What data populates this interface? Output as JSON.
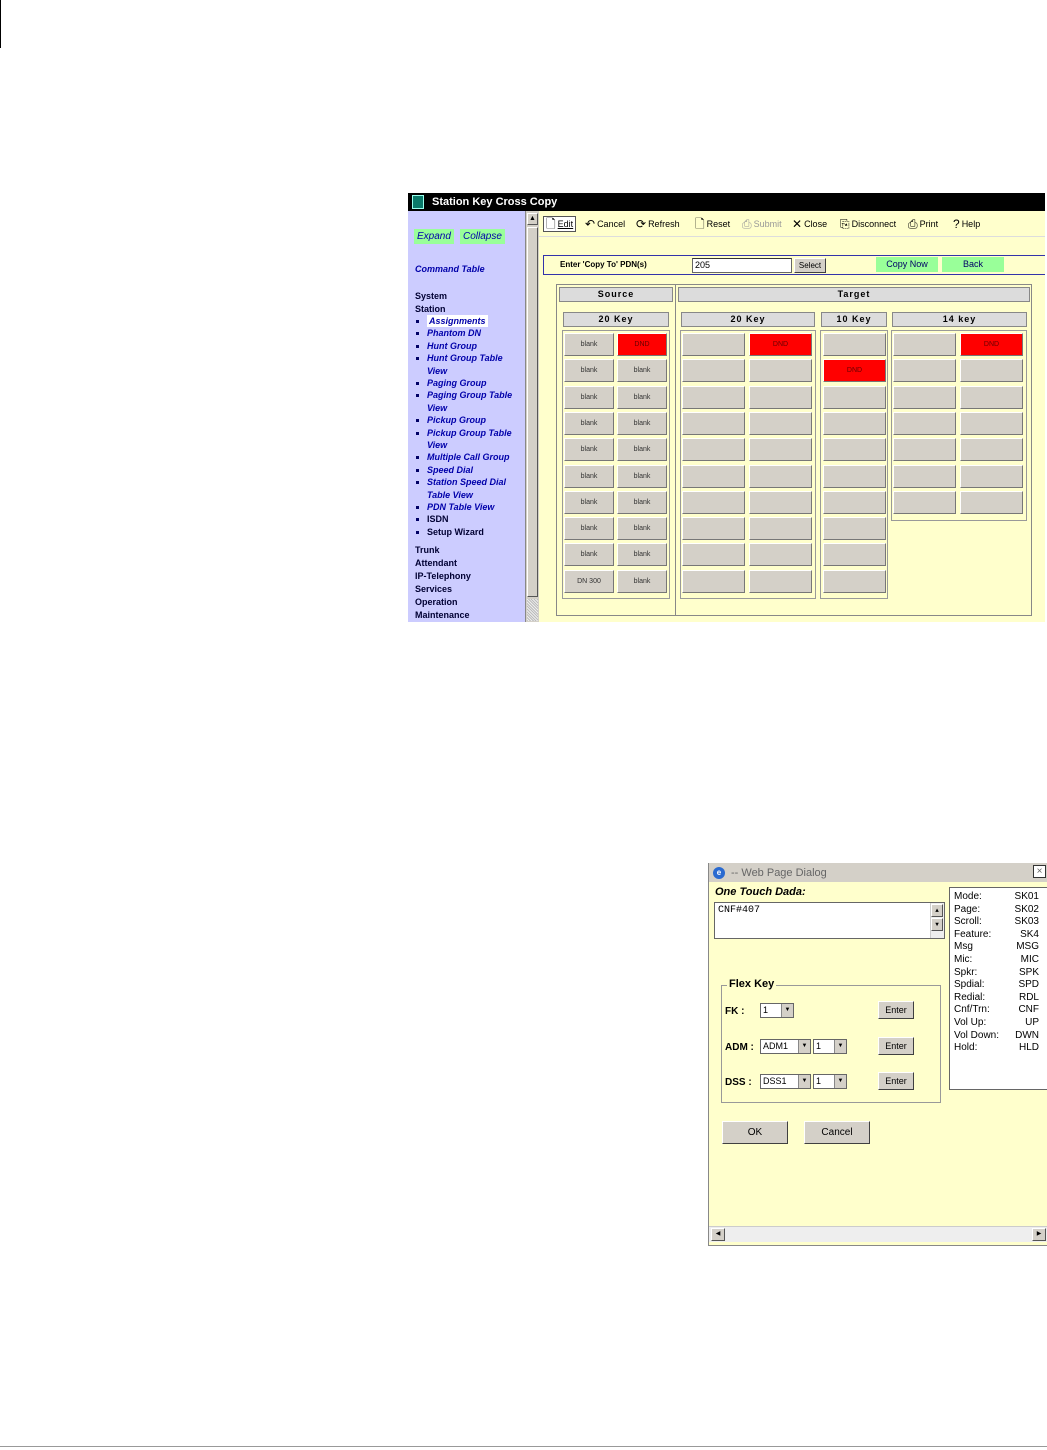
{
  "station_window": {
    "title": "Station Key Cross Copy",
    "sidebar": {
      "expand_label": "Expand",
      "collapse_label": "Collapse",
      "command_table_label": "Command Table",
      "system_label": "System",
      "station_label": "Station",
      "station_items": [
        "Assignments",
        "Phantom DN",
        "Hunt Group",
        "Hunt Group Table",
        "View",
        "Paging Group",
        "Paging Group Table",
        "View",
        "Pickup Group",
        "Pickup Group Table",
        "View",
        "Multiple Call Group",
        "Speed Dial",
        "Station Speed Dial",
        "Table View",
        "PDN Table View",
        "ISDN",
        "Setup Wizard"
      ],
      "trunk_label": "Trunk",
      "attendant_label": "Attendant",
      "ip_telephony_label": "IP-Telephony",
      "services_label": "Services",
      "operation_label": "Operation",
      "maintenance_label": "Maintenance"
    },
    "toolbar": {
      "edit_label": "Edit",
      "cancel_label": "Cancel",
      "refresh_label": "Refresh",
      "reset_label": "Reset",
      "submit_label": "Submit",
      "close_label": "Close",
      "disconnect_label": "Disconnect",
      "print_label": "Print",
      "help_label": "Help"
    },
    "command_bar": {
      "prompt_label": "Enter 'Copy To' PDN(s)",
      "pdn_value": "205",
      "select_label": "Select",
      "copy_now_label": "Copy Now",
      "back_label": "Back"
    },
    "headers": {
      "source": "Source",
      "target": "Target",
      "source_20key": "20 Key",
      "target_20key": "20 Key",
      "target_10key": "10 Key",
      "target_14key": "14 key"
    },
    "source_keys": [
      [
        "blank",
        "DND"
      ],
      [
        "blank",
        "blank"
      ],
      [
        "blank",
        "blank"
      ],
      [
        "blank",
        "blank"
      ],
      [
        "blank",
        "blank"
      ],
      [
        "blank",
        "blank"
      ],
      [
        "blank",
        "blank"
      ],
      [
        "blank",
        "blank"
      ],
      [
        "blank",
        "blank"
      ],
      [
        "DN 300",
        "blank"
      ]
    ],
    "target20_keys": [
      [
        "",
        "DND"
      ],
      [
        "",
        ""
      ],
      [
        "",
        ""
      ],
      [
        "",
        ""
      ],
      [
        "",
        ""
      ],
      [
        "",
        ""
      ],
      [
        "",
        ""
      ],
      [
        "",
        ""
      ],
      [
        "",
        ""
      ],
      [
        "",
        ""
      ]
    ],
    "target10_keys": [
      "",
      "DND",
      "",
      "",
      "",
      "",
      "",
      "",
      "",
      ""
    ],
    "target14_keys": [
      [
        "",
        "DND"
      ],
      [
        "",
        ""
      ],
      [
        "",
        ""
      ],
      [
        "",
        ""
      ],
      [
        "",
        ""
      ],
      [
        "",
        ""
      ],
      [
        "",
        ""
      ]
    ]
  },
  "dialog": {
    "title": "-- Web Page Dialog",
    "close_label": "×",
    "one_touch_label": "One Touch Dada:",
    "one_touch_value": "CNF#407",
    "codes": [
      {
        "name": "Mode:",
        "code": "SK01"
      },
      {
        "name": "Page:",
        "code": "SK02"
      },
      {
        "name": "Scroll:",
        "code": "SK03"
      },
      {
        "name": "Feature:",
        "code": "SK4"
      },
      {
        "name": "Msg",
        "code": "MSG"
      },
      {
        "name": "Mic:",
        "code": "MIC"
      },
      {
        "name": "Spkr:",
        "code": "SPK"
      },
      {
        "name": "Spdial:",
        "code": "SPD"
      },
      {
        "name": "Redial:",
        "code": "RDL"
      },
      {
        "name": "Cnf/Trn:",
        "code": "CNF"
      },
      {
        "name": "Vol Up:",
        "code": "UP"
      },
      {
        "name": "Vol Down:",
        "code": "DWN"
      },
      {
        "name": "Hold:",
        "code": "HLD"
      }
    ],
    "flex_key_legend": "Flex Key",
    "fk_label": "FK :",
    "fk_value": "1",
    "adm_label": "ADM :",
    "adm_value": "ADM1",
    "adm_num_value": "1",
    "dss_label": "DSS :",
    "dss_value": "DSS1",
    "dss_num_value": "1",
    "enter_label": "Enter",
    "ok_label": "OK",
    "cancel_label": "Cancel"
  }
}
